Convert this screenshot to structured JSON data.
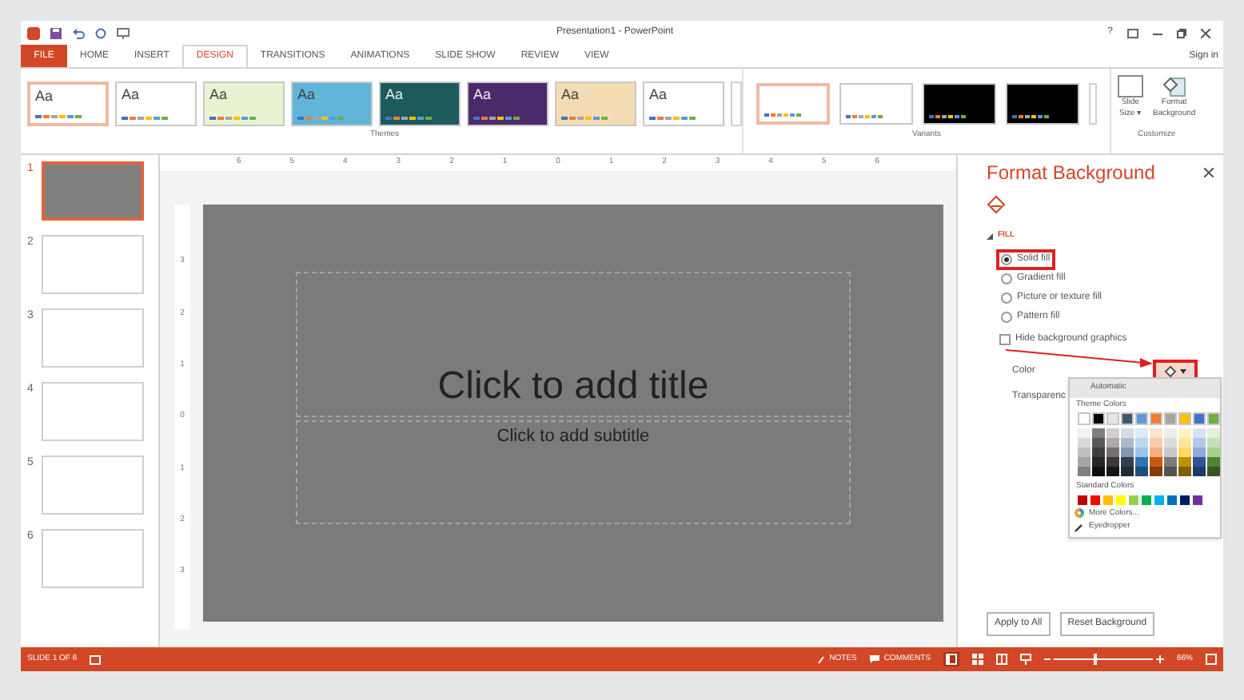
{
  "window": {
    "title": "Presentation1 - PowerPoint",
    "help": "?",
    "sign_in": "Sign in"
  },
  "tabs": [
    {
      "label": "FILE",
      "kind": "file",
      "selected": false
    },
    {
      "label": "HOME",
      "kind": "tab",
      "selected": false
    },
    {
      "label": "INSERT",
      "kind": "tab",
      "selected": false
    },
    {
      "label": "DESIGN",
      "kind": "tab",
      "selected": true
    },
    {
      "label": "TRANSITIONS",
      "kind": "tab",
      "selected": false
    },
    {
      "label": "ANIMATIONS",
      "kind": "tab",
      "selected": false
    },
    {
      "label": "SLIDE SHOW",
      "kind": "tab",
      "selected": false
    },
    {
      "label": "REVIEW",
      "kind": "tab",
      "selected": false
    },
    {
      "label": "VIEW",
      "kind": "tab",
      "selected": false
    }
  ],
  "themes": {
    "label": "Themes",
    "items": [
      {
        "label": "Aa",
        "color": "#ffffff",
        "selected": true
      },
      {
        "label": "Aa",
        "color": "#ffffff",
        "selected": false
      },
      {
        "label": "Aa",
        "color": "#e9f3d2",
        "selected": false
      },
      {
        "label": "Aa",
        "color": "#5fb6d9",
        "selected": false
      },
      {
        "label": "Aa",
        "color": "#1d5a5c",
        "selected": false
      },
      {
        "label": "Aa",
        "color": "#4b2a6b",
        "selected": false
      },
      {
        "label": "Aa",
        "color": "#f3dcb3",
        "selected": false
      },
      {
        "label": "Aa",
        "color": "#ffffff",
        "selected": false
      }
    ]
  },
  "variants": {
    "label": "Variants",
    "items": [
      {
        "color": "#ffffff",
        "selected": true
      },
      {
        "color": "#ffffff",
        "selected": false
      },
      {
        "color": "#000000",
        "selected": false
      },
      {
        "color": "#000000",
        "selected": false
      }
    ]
  },
  "customize": {
    "label": "Customize",
    "buttons": [
      {
        "kind": "slide_size",
        "line1": "Slide",
        "line2": "Size ▾"
      },
      {
        "kind": "format_background",
        "line1": "Format",
        "line2": "Background"
      }
    ]
  },
  "ruler": {
    "ticks": [
      "6",
      "5",
      "4",
      "3",
      "2",
      "1",
      "0",
      "1",
      "2",
      "3",
      "4",
      "5",
      "6"
    ],
    "vertical_ticks": [
      "3",
      "2",
      "1",
      "0",
      "1",
      "2",
      "3"
    ]
  },
  "slides": [
    {
      "number": "1",
      "selected": true
    },
    {
      "number": "2",
      "selected": false
    },
    {
      "number": "3",
      "selected": false
    },
    {
      "number": "4",
      "selected": false
    },
    {
      "number": "5",
      "selected": false
    },
    {
      "number": "6",
      "selected": false
    }
  ],
  "slide": {
    "title": "Click to add title",
    "subtitle": "Click to add subtitle"
  },
  "format_pane": {
    "title": "Format Background",
    "section": {
      "label": "FILL",
      "expanded": true
    },
    "options": [
      {
        "label": "Solid fill",
        "selected": true,
        "highlighted": true
      },
      {
        "label": "Gradient fill",
        "selected": false,
        "highlighted": false
      },
      {
        "label": "Picture or texture fill",
        "selected": false,
        "highlighted": false
      },
      {
        "label": "Pattern fill",
        "selected": false,
        "highlighted": false
      }
    ],
    "hide_graphics": {
      "label": "Hide background graphics",
      "checked": false
    },
    "color_label": "Color",
    "color_button_highlighted": true,
    "transparency_label": "Transparenc",
    "buttons": [
      "Apply to All",
      "Reset Background"
    ]
  },
  "color_menu": {
    "automatic": "Automatic",
    "theme_label": "Theme Colors",
    "theme_columns": [
      {
        "swatches": [
          {
            "color": "#ffffff"
          },
          {
            "color": "#f2f2f2"
          },
          {
            "color": "#d9d9d9"
          },
          {
            "color": "#bfbfbf"
          },
          {
            "color": "#a6a6a6"
          },
          {
            "color": "#808080"
          }
        ]
      },
      {
        "swatches": [
          {
            "color": "#000000"
          },
          {
            "color": "#7f7f7f"
          },
          {
            "color": "#595959"
          },
          {
            "color": "#3f3f3f"
          },
          {
            "color": "#262626"
          },
          {
            "color": "#0d0d0d"
          }
        ]
      },
      {
        "swatches": [
          {
            "color": "#e7e6e6"
          },
          {
            "color": "#d0cece"
          },
          {
            "color": "#aeaaaa"
          },
          {
            "color": "#757070"
          },
          {
            "color": "#3a3838"
          },
          {
            "color": "#171616"
          }
        ]
      },
      {
        "swatches": [
          {
            "color": "#44546a"
          },
          {
            "color": "#d6dce4"
          },
          {
            "color": "#adb9ca"
          },
          {
            "color": "#8497b0"
          },
          {
            "color": "#333f4f"
          },
          {
            "color": "#222a35"
          }
        ]
      },
      {
        "swatches": [
          {
            "color": "#5b9bd5"
          },
          {
            "color": "#deebf6"
          },
          {
            "color": "#bdd7ee"
          },
          {
            "color": "#9dc3e6"
          },
          {
            "color": "#2e75b5"
          },
          {
            "color": "#1f4e79"
          }
        ]
      },
      {
        "swatches": [
          {
            "color": "#ed7d31"
          },
          {
            "color": "#fbe5d5"
          },
          {
            "color": "#f7cbac"
          },
          {
            "color": "#f4b183"
          },
          {
            "color": "#c55a11"
          },
          {
            "color": "#833c0b"
          }
        ]
      },
      {
        "swatches": [
          {
            "color": "#a5a5a5"
          },
          {
            "color": "#ededed"
          },
          {
            "color": "#dbdbdb"
          },
          {
            "color": "#c9c9c9"
          },
          {
            "color": "#7b7b7b"
          },
          {
            "color": "#525252"
          }
        ]
      },
      {
        "swatches": [
          {
            "color": "#ffc000"
          },
          {
            "color": "#fff2cc"
          },
          {
            "color": "#ffe699"
          },
          {
            "color": "#ffd966"
          },
          {
            "color": "#bf9000"
          },
          {
            "color": "#7f6000"
          }
        ]
      },
      {
        "swatches": [
          {
            "color": "#4472c4"
          },
          {
            "color": "#dae3f3"
          },
          {
            "color": "#b4c7e7"
          },
          {
            "color": "#8faadc"
          },
          {
            "color": "#2f5597"
          },
          {
            "color": "#203864"
          }
        ]
      },
      {
        "swatches": [
          {
            "color": "#70ad47"
          },
          {
            "color": "#e2f0d9"
          },
          {
            "color": "#c5e0b4"
          },
          {
            "color": "#a9d18e"
          },
          {
            "color": "#538135"
          },
          {
            "color": "#375623"
          }
        ]
      }
    ],
    "standard_label": "Standard Colors",
    "standard": [
      {
        "color": "#c00000"
      },
      {
        "color": "#ff0000"
      },
      {
        "color": "#ffc000"
      },
      {
        "color": "#ffff00"
      },
      {
        "color": "#92d050"
      },
      {
        "color": "#00b050"
      },
      {
        "color": "#00b0f0"
      },
      {
        "color": "#0070c0"
      },
      {
        "color": "#002060"
      },
      {
        "color": "#7030a0"
      }
    ],
    "more": "More Colors...",
    "eyedropper": "Eyedropper"
  },
  "status_bar": {
    "slide_info": "SLIDE 1 OF 6",
    "notes": "NOTES",
    "comments": "COMMENTS",
    "zoom": "66%",
    "zoom_slider": {
      "level": 0.4
    }
  }
}
